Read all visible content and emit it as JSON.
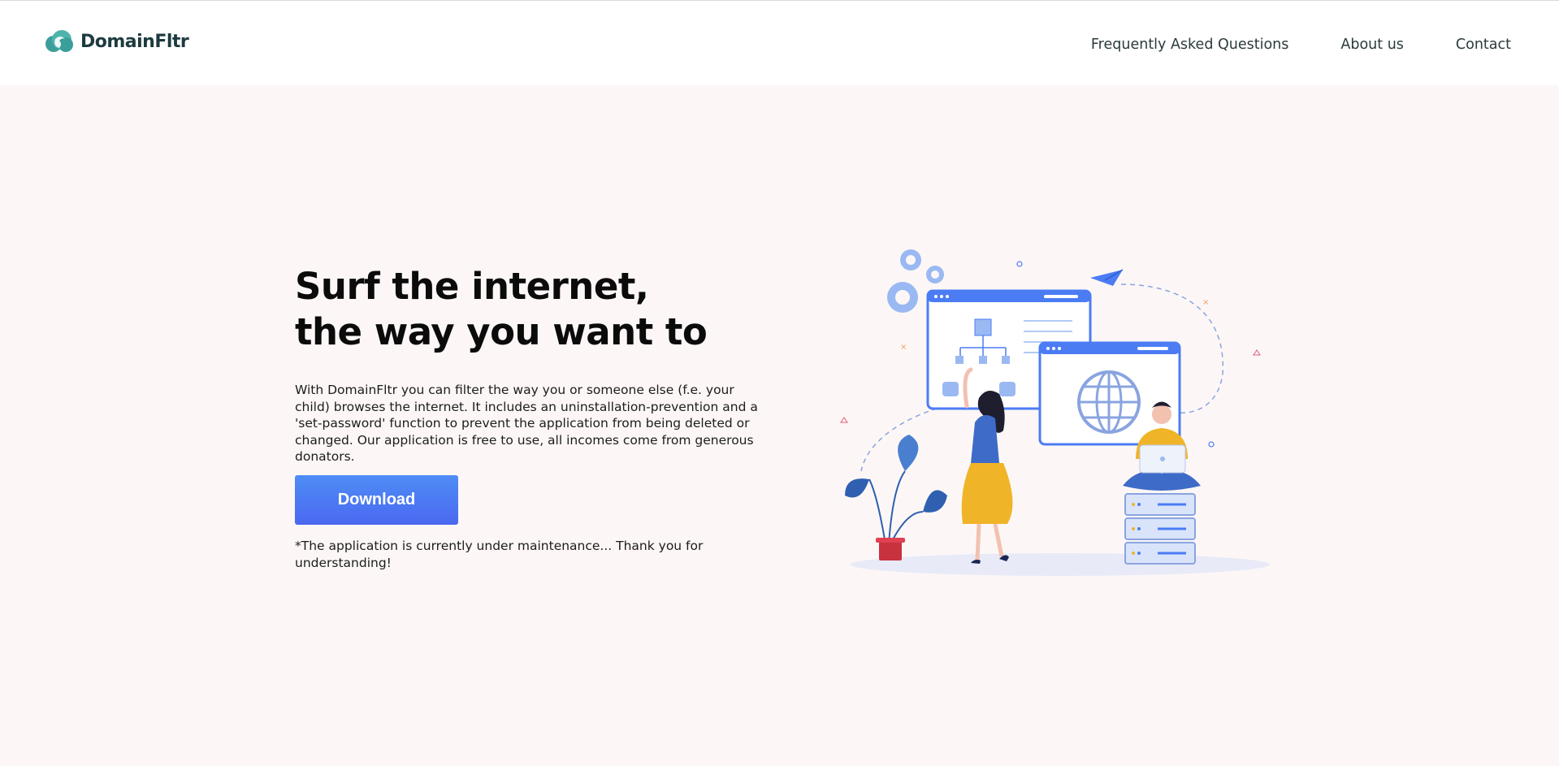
{
  "brand": {
    "name": "DomainFltr"
  },
  "nav": {
    "items": [
      {
        "label": "Frequently Asked Questions"
      },
      {
        "label": "About us"
      },
      {
        "label": "Contact"
      }
    ]
  },
  "hero": {
    "title_line1": "Surf the internet,",
    "title_line2": "the way you want to",
    "description": "With DomainFltr you can filter the way you or someone else (f.e. your child) browses the internet. It includes an uninstallation-prevention and a 'set-password' function to prevent the application from being deleted or changed. Our application is free to use, all incomes come from generous donators.",
    "download_label": "Download",
    "maintenance_note": "*The application is currently under maintenance... Thank you for understanding!"
  },
  "colors": {
    "brand_teal": "#3a9e9a",
    "accent_blue": "#4b7cf4",
    "page_bg": "#fcf7f6"
  },
  "icons": {
    "logo": "cloud-logo-icon",
    "illustration": "people-browsing-illustration"
  }
}
